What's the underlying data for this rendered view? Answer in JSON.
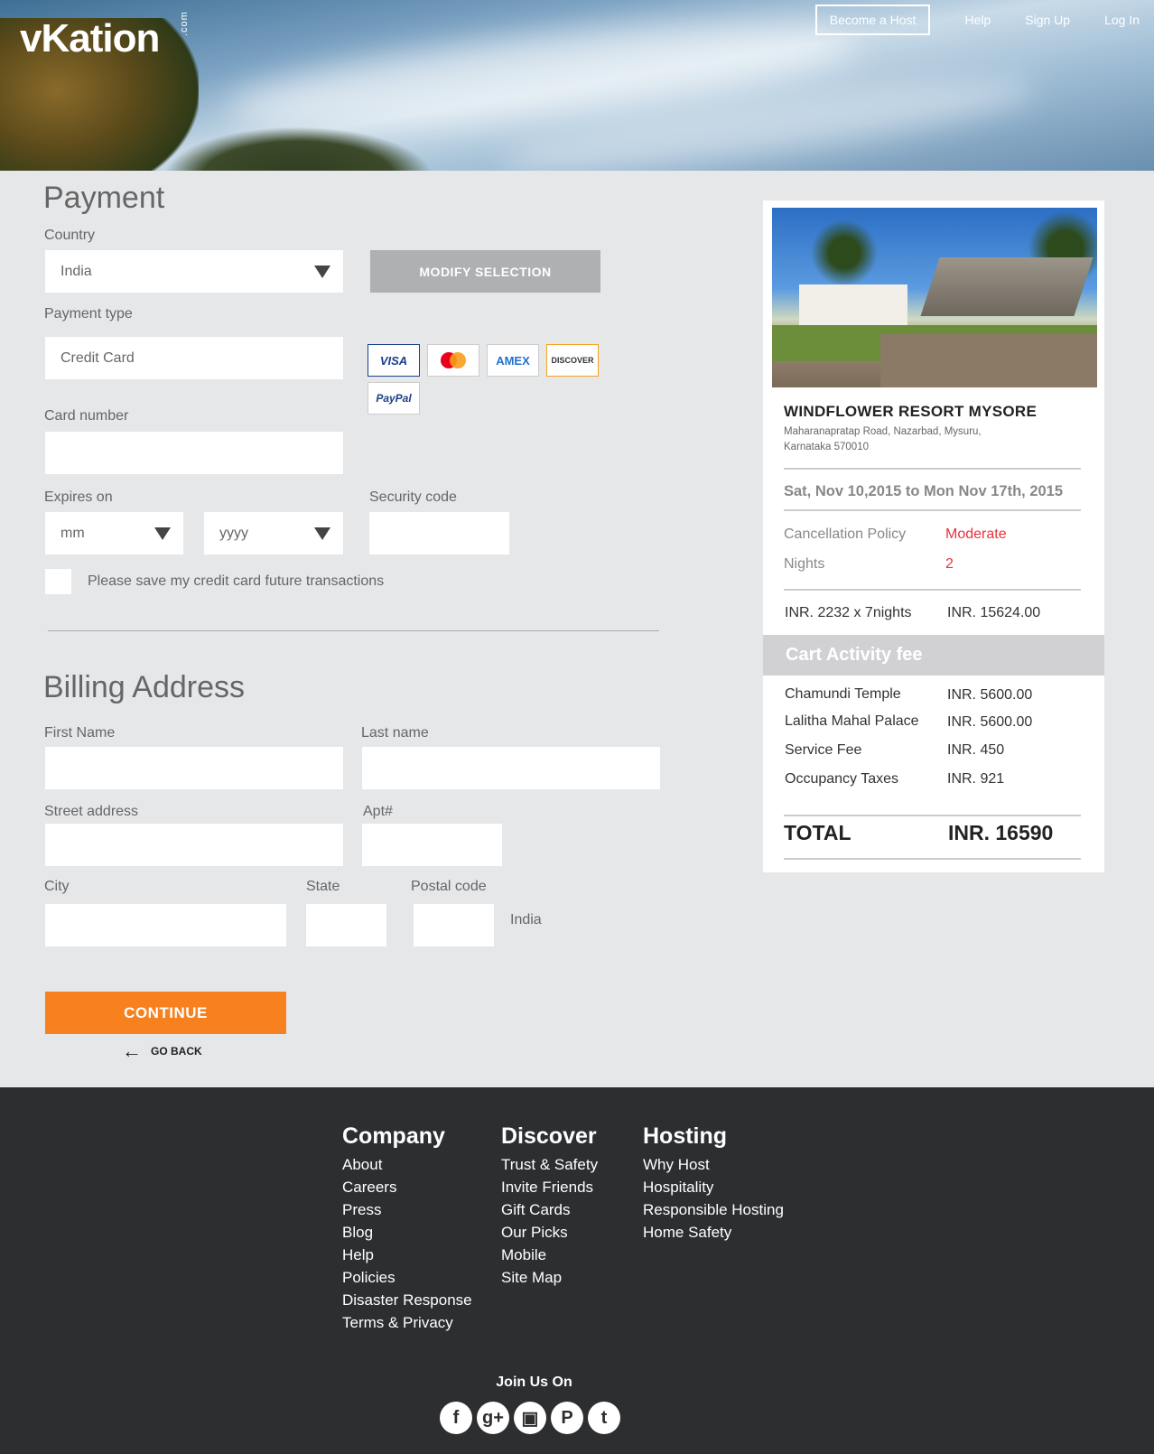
{
  "header": {
    "logo_text": "vKation",
    "logo_suffix": ".com",
    "become_host": "Become a Host",
    "help": "Help",
    "sign_up": "Sign Up",
    "log_in": "Log In"
  },
  "payment": {
    "title": "Payment",
    "country_label": "Country",
    "country_value": "India",
    "modify_button": "MODIFY  SELECTION",
    "payment_type_label": "Payment type",
    "payment_type_value": "Credit Card",
    "cards": [
      "VISA",
      "MasterCard",
      "AMEX",
      "DISCOVER",
      "PayPal"
    ],
    "card_number_label": "Card number",
    "card_number_value": "",
    "expires_label": "Expires on",
    "expires_month_value": "mm",
    "expires_year_value": "yyyy",
    "security_label": "Security code",
    "security_value": "",
    "save_card_label": "Please save my credit card future transactions",
    "save_card_checked": false
  },
  "billing": {
    "title": "Billing Address",
    "first_name_label": "First Name",
    "last_name_label": "Last name",
    "street_label": "Street address",
    "apt_label": "Apt#",
    "city_label": "City",
    "state_label": "State",
    "postal_label": "Postal code",
    "country_text": "India"
  },
  "actions": {
    "continue": "CONTINUE",
    "go_back": "GO BACK"
  },
  "summary": {
    "resort_name": "WINDFLOWER RESORT MYSORE",
    "address_line1": "Maharanapratap Road, Nazarbad, Mysuru,",
    "address_line2": "Karnataka 570010",
    "dates": "Sat, Nov 10,2015 to Mon Nov 17th, 2015",
    "cancellation_label": "Cancellation Policy",
    "cancellation_value": "Moderate",
    "nights_label": "Nights",
    "nights_value": "2",
    "rate_label": "INR. 2232 x 7nights",
    "rate_value": "INR. 15624.00",
    "cart_title": "Cart Activity fee",
    "fees": [
      {
        "label": "Chamundi Temple",
        "value": "INR. 5600.00"
      },
      {
        "label": "Lalitha Mahal Palace",
        "value": "INR. 5600.00"
      },
      {
        "label": "Service Fee",
        "value": "INR. 450"
      },
      {
        "label": "Occupancy Taxes",
        "value": "INR. 921"
      }
    ],
    "total_label": "TOTAL",
    "total_value": "INR. 16590",
    "accent_color": "#e8323c"
  },
  "footer": {
    "company_title": "Company",
    "company_links": [
      "About",
      "Careers",
      "Press",
      "Blog",
      "Help",
      "Policies",
      "Disaster Response",
      "Terms & Privacy"
    ],
    "discover_title": "Discover",
    "discover_links": [
      "Trust & Safety",
      "Invite Friends",
      "Gift Cards",
      "Our Picks",
      "Mobile",
      "Site Map"
    ],
    "hosting_title": "Hosting",
    "hosting_links": [
      "Why Host",
      "Hospitality",
      "Responsible Hosting",
      "Home Safety"
    ],
    "join_us": "Join Us On",
    "social": [
      {
        "icon": "facebook-icon",
        "glyph": "f"
      },
      {
        "icon": "google-plus-icon",
        "glyph": "g+"
      },
      {
        "icon": "instagram-icon",
        "glyph": "▣"
      },
      {
        "icon": "pinterest-icon",
        "glyph": "P"
      },
      {
        "icon": "twitter-icon",
        "glyph": "t"
      }
    ]
  }
}
